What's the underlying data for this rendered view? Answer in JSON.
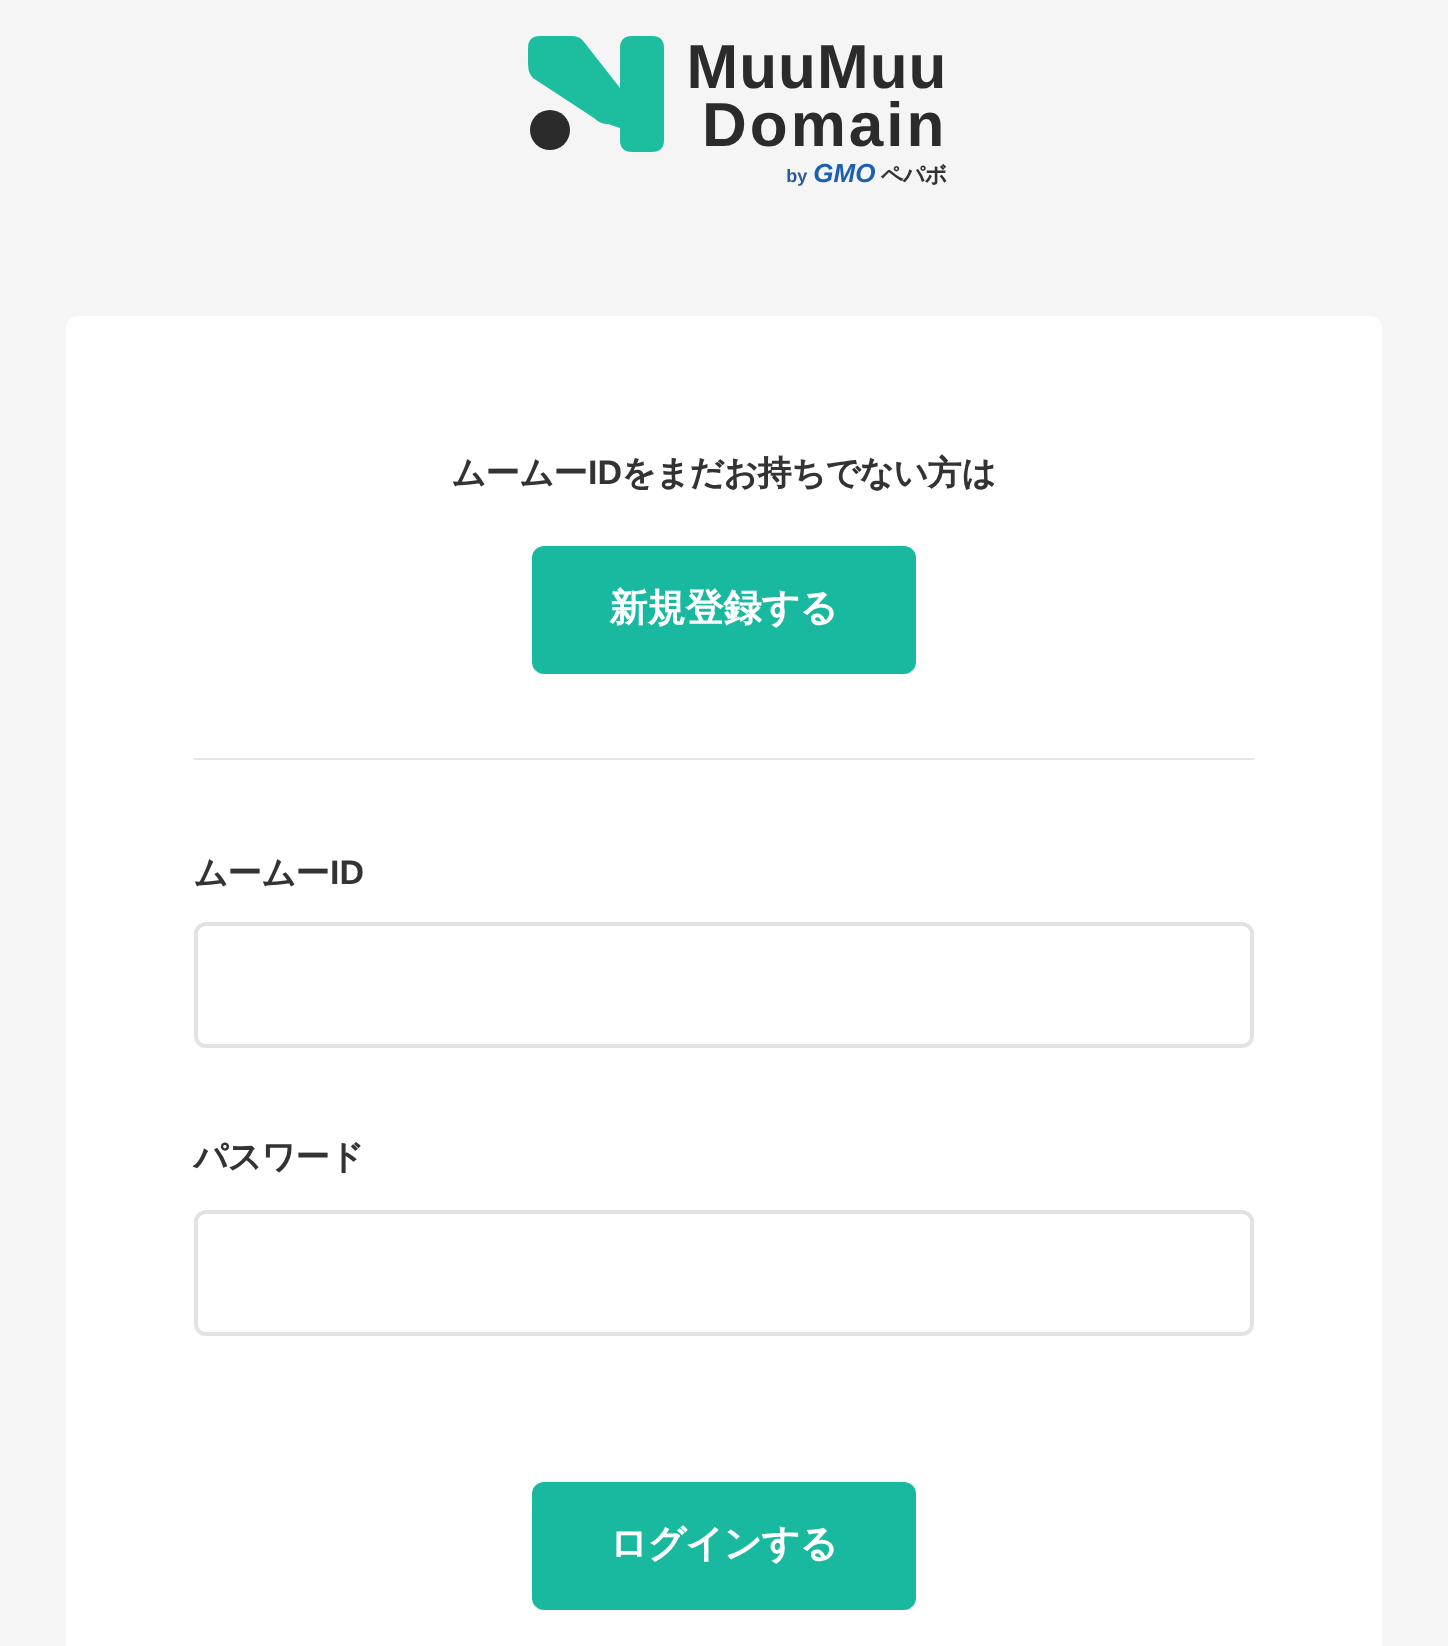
{
  "logo": {
    "line1": "MuuMuu",
    "line2": "Domain",
    "by": "by",
    "group": "GMO",
    "company": "ペパボ"
  },
  "signup": {
    "prompt": "ムームーIDをまだお持ちでない方は",
    "button": "新規登録する"
  },
  "fields": [
    {
      "label": "ムームーID"
    },
    {
      "label": "パスワード"
    }
  ],
  "login_button": "ログインする"
}
